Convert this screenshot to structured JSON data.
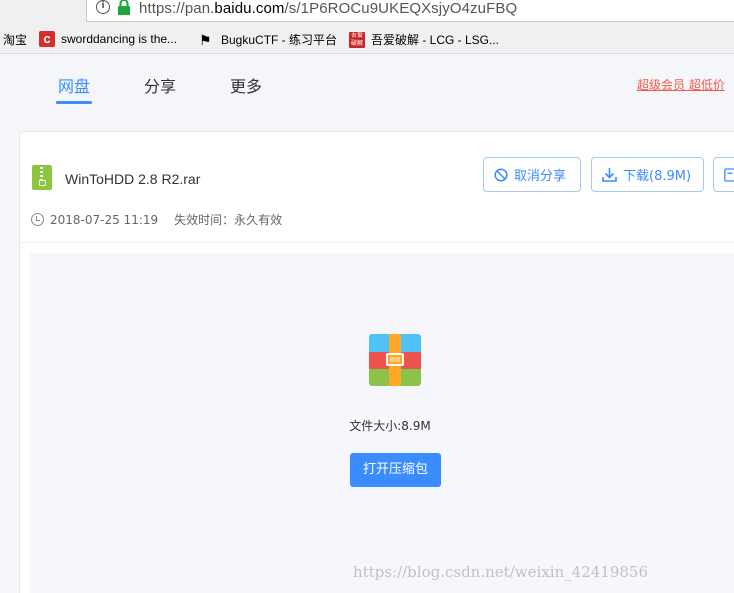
{
  "browser": {
    "url_prefix": "https://pan.",
    "url_host": "baidu.com",
    "url_path": "/s/1P6ROCu9UKEQXsjyO4zuFBQ"
  },
  "bookmarks": [
    {
      "label": "淘宝",
      "icon": "taobao-icon"
    },
    {
      "label": "sworddancing is the...",
      "icon": "c-logo-icon"
    },
    {
      "label": "BugkuCTF - 练习平台",
      "icon": "flag-icon"
    },
    {
      "label": "吾爱破解 - LCG - LSG...",
      "icon": "lcg-icon"
    }
  ],
  "nav": {
    "tabs": [
      "网盘",
      "分享",
      "更多"
    ],
    "active_tab": "网盘",
    "vip_link": "超级会员 超低价"
  },
  "file": {
    "name": "WinToHDD 2.8 R2.rar",
    "date": "2018-07-25 11:19",
    "expire": "失效时间：永久有效",
    "size_text": "文件大小:8.9M"
  },
  "actions": {
    "cancel_share": "取消分享",
    "download": "下载(8.9M)",
    "open_archive": "打开压缩包"
  },
  "watermark": "https://blog.csdn.net/weixin_42419856",
  "colors": {
    "accent": "#3b8cff",
    "vip": "#f25b4b",
    "archive_icon": [
      "#4fc3f7",
      "#ef5350",
      "#8bc34a",
      "#ffa726"
    ]
  }
}
